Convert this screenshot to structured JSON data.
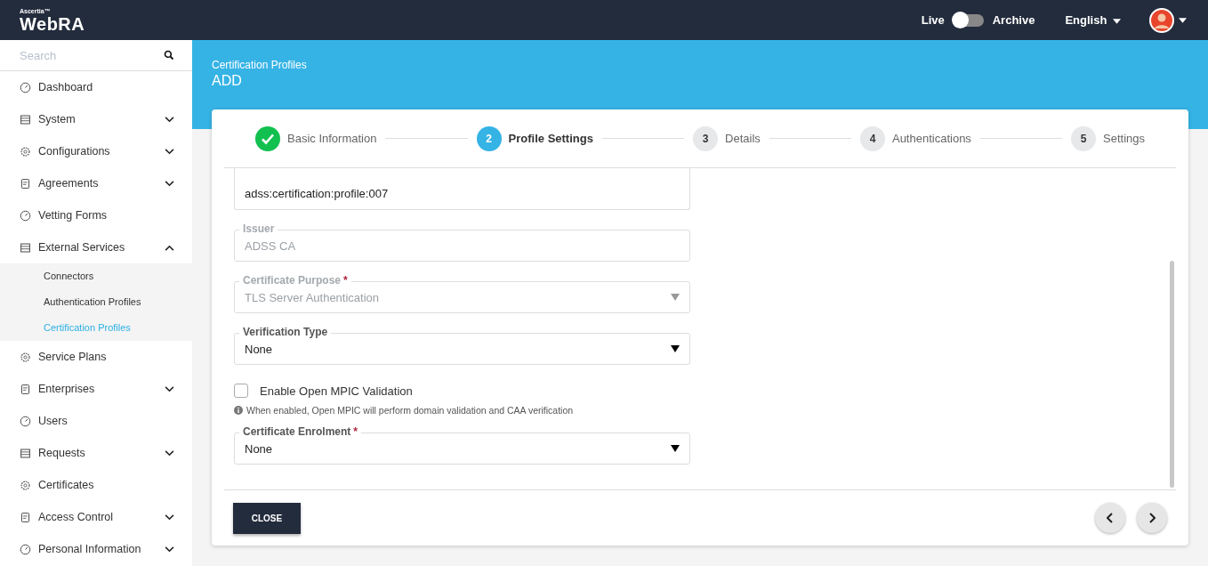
{
  "header": {
    "brand_small": "Ascertia™",
    "brand": "WebRA",
    "mode_left": "Live",
    "mode_right": "Archive",
    "archive_on": false,
    "language": "English"
  },
  "sidebar": {
    "search": {
      "placeholder": "Search"
    },
    "items": [
      {
        "label": "Dashboard",
        "expandable": false
      },
      {
        "label": "System",
        "expandable": true,
        "expanded": false
      },
      {
        "label": "Configurations",
        "expandable": true,
        "expanded": false
      },
      {
        "label": "Agreements",
        "expandable": true,
        "expanded": false
      },
      {
        "label": "Vetting Forms",
        "expandable": false
      },
      {
        "label": "External Services",
        "expandable": true,
        "expanded": true,
        "children": [
          {
            "label": "Connectors",
            "selected": false
          },
          {
            "label": "Authentication Profiles",
            "selected": false
          },
          {
            "label": "Certification Profiles",
            "selected": true
          }
        ]
      },
      {
        "label": "Service Plans",
        "expandable": false
      },
      {
        "label": "Enterprises",
        "expandable": true,
        "expanded": false
      },
      {
        "label": "Users",
        "expandable": false
      },
      {
        "label": "Requests",
        "expandable": true,
        "expanded": false
      },
      {
        "label": "Certificates",
        "expandable": false
      },
      {
        "label": "Access Control",
        "expandable": true,
        "expanded": false
      },
      {
        "label": "Personal Information",
        "expandable": true,
        "expanded": false
      }
    ]
  },
  "page": {
    "breadcrumb": "Certification Profiles",
    "title": "ADD"
  },
  "steps": [
    {
      "label": "Basic Information",
      "done": true,
      "selected": false
    },
    {
      "number": "2",
      "label": "Profile Settings",
      "done": false,
      "selected": true
    },
    {
      "number": "3",
      "label": "Details",
      "done": false,
      "selected": false
    },
    {
      "number": "4",
      "label": "Authentications",
      "done": false,
      "selected": false
    },
    {
      "number": "5",
      "label": "Settings",
      "done": false,
      "selected": false
    }
  ],
  "fields": [
    {
      "kind": "text",
      "value": "adss:certification:profile:007",
      "disabled": false
    },
    {
      "kind": "text",
      "label": "Issuer",
      "value": "ADSS CA",
      "disabled": true
    },
    {
      "kind": "select",
      "label": "Certificate Purpose",
      "required_mark": "*",
      "value": "TLS Server Authentication",
      "disabled": true
    },
    {
      "kind": "select",
      "label": "Verification Type",
      "value": "None",
      "disabled": false
    },
    {
      "kind": "checkbox",
      "label": "Enable Open MPIC Validation",
      "checked": false,
      "hint": "When enabled, Open MPIC will perform domain validation and CAA verification"
    },
    {
      "kind": "select",
      "label": "Certificate Enrolment",
      "required_mark": "*",
      "value": "None",
      "disabled": false
    }
  ],
  "footer": {
    "close": "CLOSE"
  }
}
